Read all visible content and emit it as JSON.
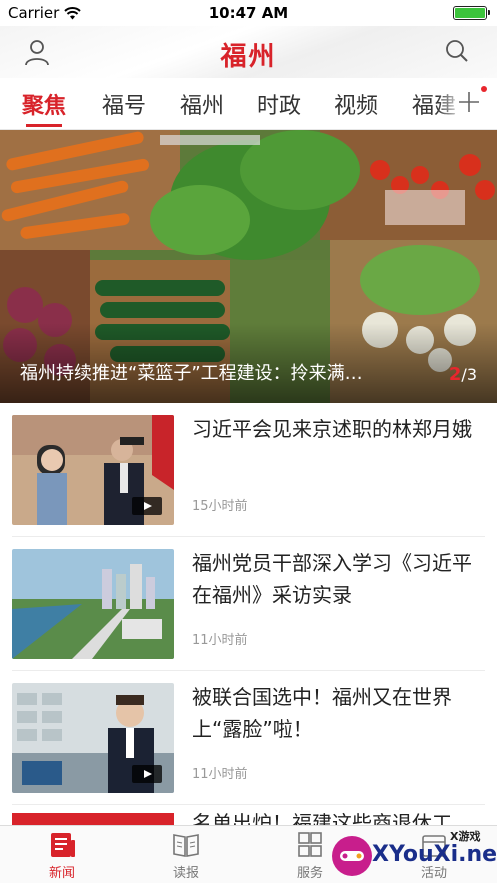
{
  "status_bar": {
    "carrier": "Carrier",
    "time": "10:47 AM",
    "battery_color": "#3cc43c"
  },
  "header": {
    "logo": "福州",
    "user_icon": "user-icon",
    "search_icon": "search-icon",
    "accent": "#d8232a"
  },
  "tabs": [
    {
      "label": "聚焦",
      "active": true
    },
    {
      "label": "福号"
    },
    {
      "label": "福州"
    },
    {
      "label": "时政"
    },
    {
      "label": "视频"
    },
    {
      "label": "福建"
    }
  ],
  "hero": {
    "caption": "福州持续推进“菜篮子”工程建设：拎来满…",
    "page_current": "2",
    "page_total": "/3"
  },
  "news": [
    {
      "title": "习近平会见来京述职的林郑月娥",
      "time": "15小时前",
      "video": true
    },
    {
      "title": "福州党员干部深入学习《习近平在福州》采访实录",
      "time": "11小时前",
      "video": false
    },
    {
      "title": "被联合国选中！福州又在世界上“露脸”啦！",
      "time": "11小时前",
      "video": true
    }
  ],
  "partial_item": {
    "title": "名单出炉！福建这些商退休工"
  },
  "bottom_nav": [
    {
      "label": "新闻",
      "icon": "news-icon",
      "active": true
    },
    {
      "label": "读报",
      "icon": "book-icon"
    },
    {
      "label": "服务",
      "icon": "grid-icon"
    },
    {
      "label": "活动",
      "icon": "event-icon"
    }
  ],
  "watermark": {
    "tag": "X游戏",
    "brand": "XYouXi.net"
  }
}
